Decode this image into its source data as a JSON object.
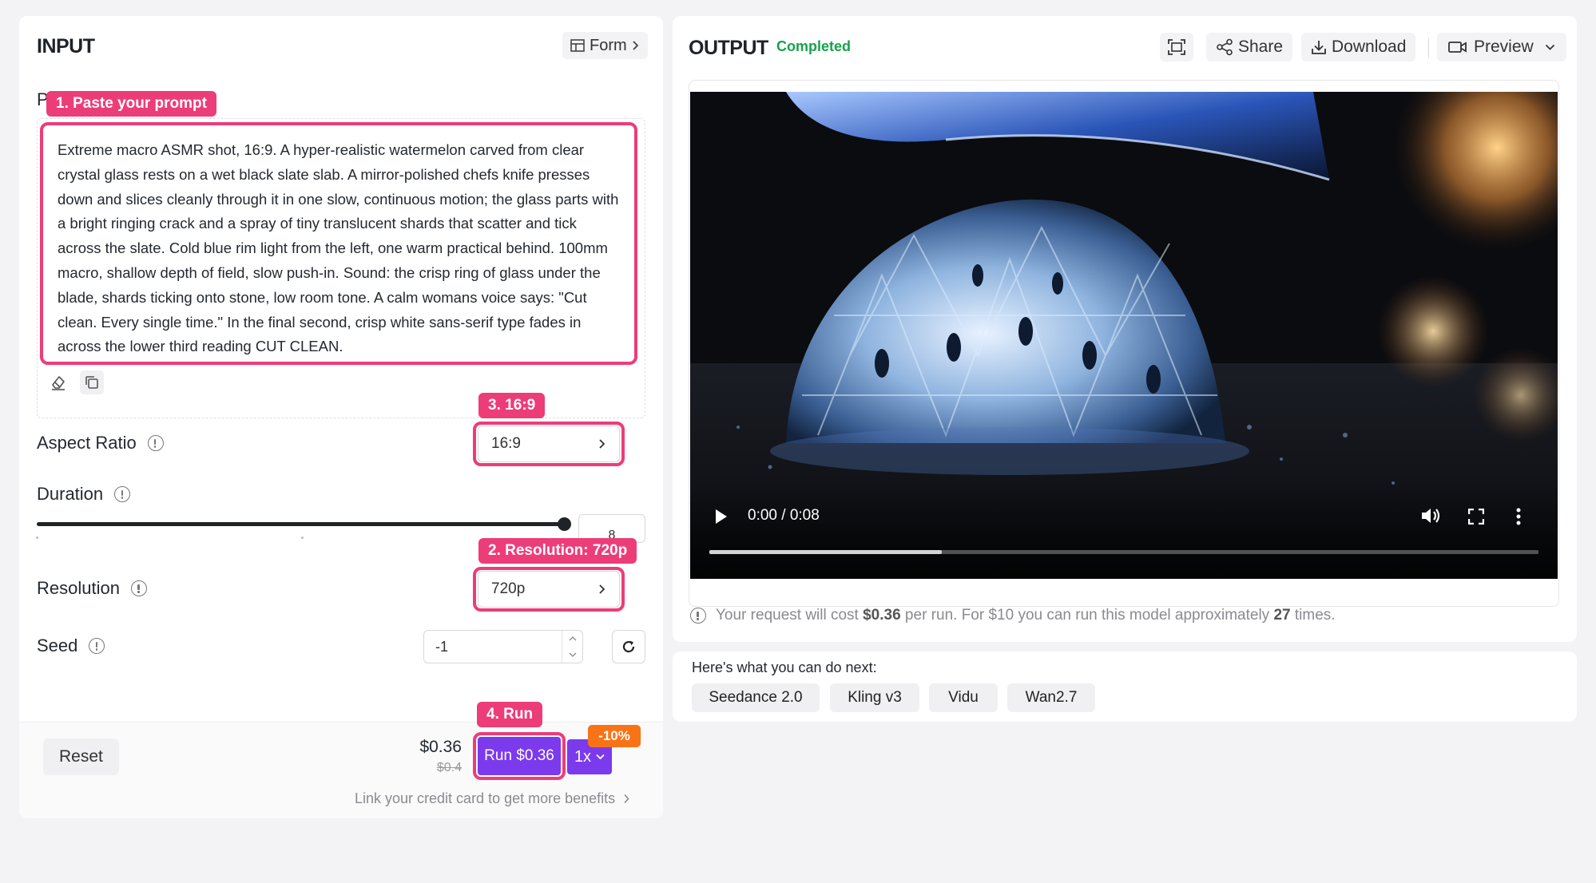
{
  "input": {
    "title": "INPUT",
    "form_button": "Form",
    "prompt_label_partial": "P",
    "prompt_text": "Extreme macro ASMR shot, 16:9. A hyper-realistic watermelon carved from clear crystal glass rests on a wet black slate slab. A mirror-polished chefs knife presses down and slices cleanly through it in one slow, continuous motion; the glass parts with a bright ringing crack and a spray of tiny translucent shards that scatter and tick across the slate. Cold blue rim light from the left, one warm practical behind. 100mm macro, shallow depth of field, slow push-in. Sound: the crisp ring of glass under the blade, shards ticking onto stone, low room tone. A calm womans voice says: \"Cut clean. Every single time.\" In the final second, crisp white sans-serif type fades in across the lower third reading CUT CLEAN.",
    "aspect_ratio": {
      "label": "Aspect Ratio",
      "value": "16:9"
    },
    "duration": {
      "label": "Duration",
      "value": "8",
      "fraction": 1.0
    },
    "resolution": {
      "label": "Resolution",
      "value": "720p"
    },
    "seed": {
      "label": "Seed",
      "value": "-1"
    },
    "reset_label": "Reset",
    "price": "$0.36",
    "price_original": "$0.4",
    "run_label": "Run $0.36",
    "multiplier": "1x",
    "discount": "-10%",
    "credit_link": "Link your credit card to get more benefits"
  },
  "annotations": {
    "step1": "1. Paste your prompt",
    "step2": "2. Resolution: 720p",
    "step3": "3. 16:9",
    "step4": "4. Run"
  },
  "output": {
    "title": "OUTPUT",
    "status": "Completed",
    "share_label": "Share",
    "download_label": "Download",
    "preview_label": "Preview",
    "video_time": "0:00 / 0:08",
    "video_progress": 0.28,
    "cost_prefix": "Your request will cost ",
    "cost_value": "$0.36",
    "cost_middle": " per run. For $10 you can run this model approximately ",
    "cost_count": "27",
    "cost_suffix": " times."
  },
  "next": {
    "heading": "Here's what you can do next:",
    "models": [
      "Seedance 2.0",
      "Kling v3",
      "Vidu",
      "Wan2.7"
    ]
  },
  "colors": {
    "accent": "#7c3aed",
    "annotation": "#ec3d79",
    "discount": "#f97316",
    "completed": "#16a34a"
  }
}
